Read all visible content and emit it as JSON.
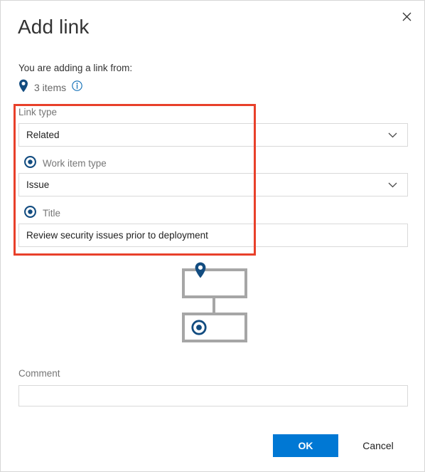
{
  "dialog": {
    "title": "Add link",
    "close_icon": "close-icon"
  },
  "source": {
    "prompt": "You are adding a link from:",
    "pin_icon": "pin-icon",
    "count_text": "3 items",
    "info_icon": "info-icon"
  },
  "annotation": {
    "color": "#e8402a"
  },
  "form": {
    "link_type": {
      "label": "Link type",
      "value": "Related",
      "chevron_icon": "chevron-down-icon"
    },
    "work_item_type": {
      "label": "Work item type",
      "radio_icon": "radio-selected-icon",
      "value": "Issue",
      "chevron_icon": "chevron-down-icon"
    },
    "title": {
      "label": "Title",
      "radio_icon": "radio-selected-icon",
      "value": "Review security issues prior to deployment",
      "placeholder": ""
    }
  },
  "diagram": {
    "top_node_icon": "pin-icon",
    "bottom_node_icon": "radio-selected-icon",
    "node_border_color": "#a6a6a6",
    "accent_color": "#records"
  },
  "comment": {
    "label": "Comment",
    "value": "",
    "placeholder": ""
  },
  "footer": {
    "ok_label": "OK",
    "cancel_label": "Cancel",
    "ok_color": "#0078d4"
  }
}
